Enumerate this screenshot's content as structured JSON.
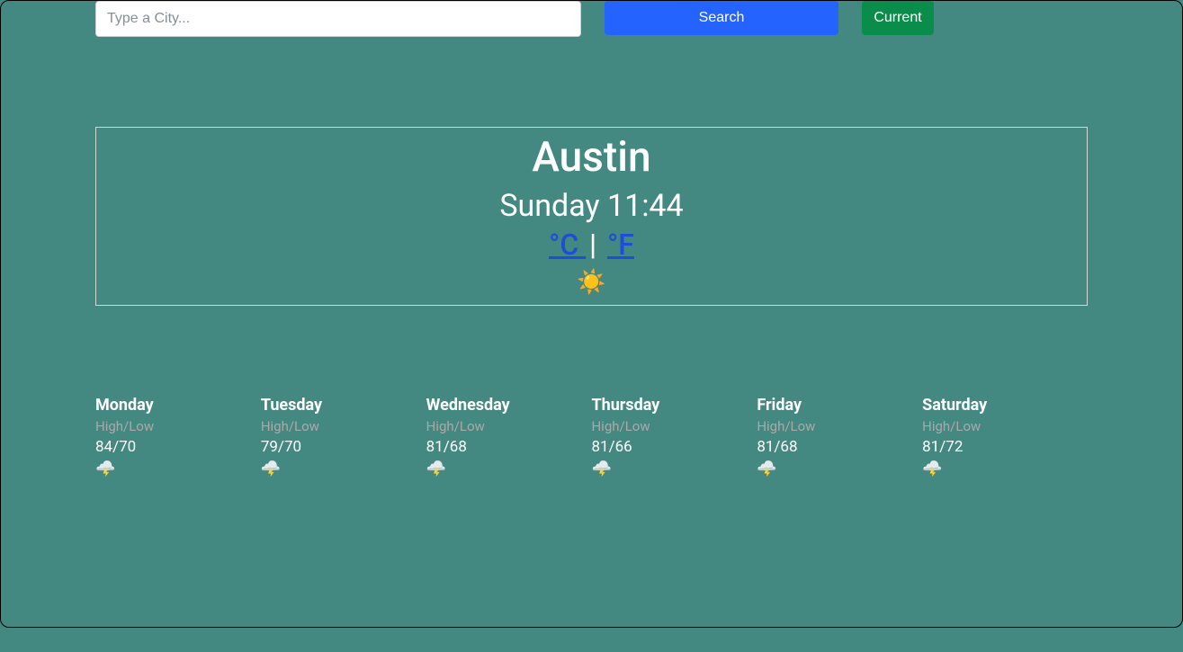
{
  "search": {
    "placeholder": "Type a City...",
    "value": "",
    "search_label": "Search",
    "current_label": "Current"
  },
  "current": {
    "city": "Austin",
    "day_time": "Sunday 11:44",
    "unit_c": "°C ",
    "unit_sep": "| ",
    "unit_f": "°F",
    "icon": "☀️"
  },
  "forecast_label": "High/Low",
  "forecast": [
    {
      "day": "Monday",
      "temps": "84/70",
      "icon": "🌩️"
    },
    {
      "day": "Tuesday",
      "temps": "79/70",
      "icon": "🌩️"
    },
    {
      "day": "Wednesday",
      "temps": "81/68",
      "icon": "🌩️"
    },
    {
      "day": "Thursday",
      "temps": "81/66",
      "icon": "🌩️"
    },
    {
      "day": "Friday",
      "temps": "81/68",
      "icon": "🌩️"
    },
    {
      "day": "Saturday",
      "temps": "81/72",
      "icon": "🌩️"
    }
  ]
}
